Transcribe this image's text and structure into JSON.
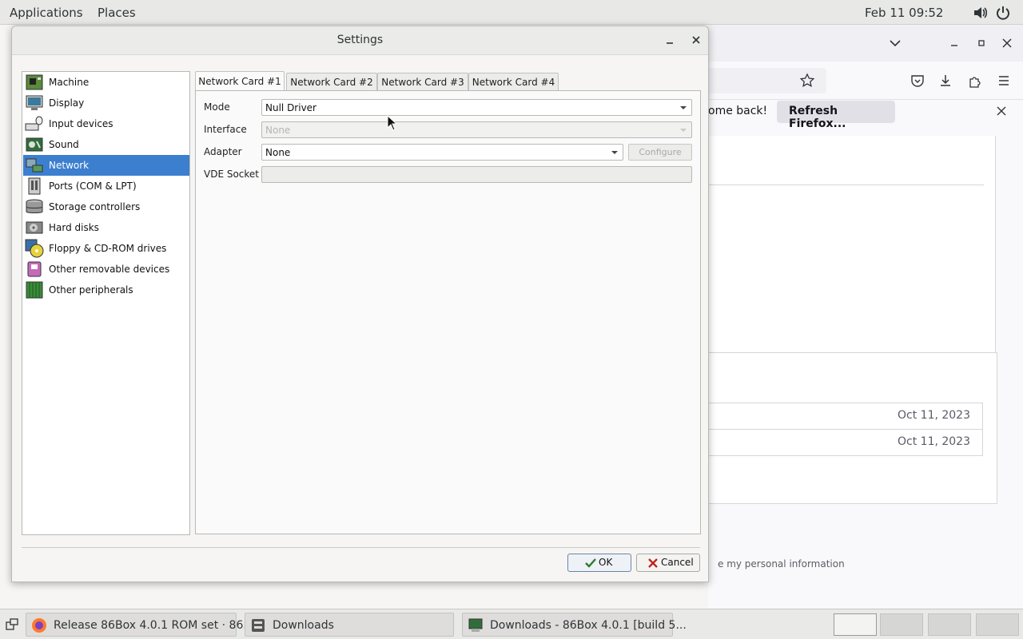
{
  "topbar": {
    "applications": "Applications",
    "places": "Places",
    "clock": "Feb 11  09:52",
    "volume_icon": "volume-icon",
    "power_icon": "power-icon"
  },
  "firefox": {
    "notice_text": "ome back!",
    "refresh_button": "Refresh Firefox...",
    "rows": [
      {
        "date": "Oct 11, 2023"
      },
      {
        "date": "Oct 11, 2023"
      }
    ],
    "privacy_text": "e my personal information"
  },
  "dialog": {
    "title": "Settings",
    "sidebar": [
      {
        "label": "Machine",
        "icon": "machine-icon"
      },
      {
        "label": "Display",
        "icon": "display-icon"
      },
      {
        "label": "Input devices",
        "icon": "input-devices-icon"
      },
      {
        "label": "Sound",
        "icon": "sound-icon"
      },
      {
        "label": "Network",
        "icon": "network-icon",
        "selected": true
      },
      {
        "label": "Ports (COM & LPT)",
        "icon": "ports-icon"
      },
      {
        "label": "Storage controllers",
        "icon": "storage-controllers-icon"
      },
      {
        "label": "Hard disks",
        "icon": "hard-disks-icon"
      },
      {
        "label": "Floppy & CD-ROM drives",
        "icon": "floppy-cdrom-icon"
      },
      {
        "label": "Other removable devices",
        "icon": "removable-devices-icon"
      },
      {
        "label": "Other peripherals",
        "icon": "peripherals-icon"
      }
    ],
    "tabs": [
      "Network Card #1",
      "Network Card #2",
      "Network Card #3",
      "Network Card #4"
    ],
    "active_tab": 0,
    "fields": {
      "mode_label": "Mode",
      "mode_value": "Null Driver",
      "interface_label": "Interface",
      "interface_value": "None",
      "adapter_label": "Adapter",
      "adapter_value": "None",
      "configure_button": "Configure",
      "vde_label": "VDE Socket",
      "vde_value": ""
    },
    "ok_button": "OK",
    "cancel_button": "Cancel"
  },
  "taskbar": {
    "tasks": [
      {
        "label": "Release 86Box 4.0.1 ROM set · 86...",
        "icon": "firefox-icon"
      },
      {
        "label": "Downloads",
        "icon": "file-manager-icon"
      },
      {
        "label": "Downloads - 86Box 4.0.1 [build 5...",
        "icon": "86box-icon"
      }
    ]
  },
  "colors": {
    "selection": "#3c7fcf",
    "dialog_bg": "#f6f5f4"
  }
}
